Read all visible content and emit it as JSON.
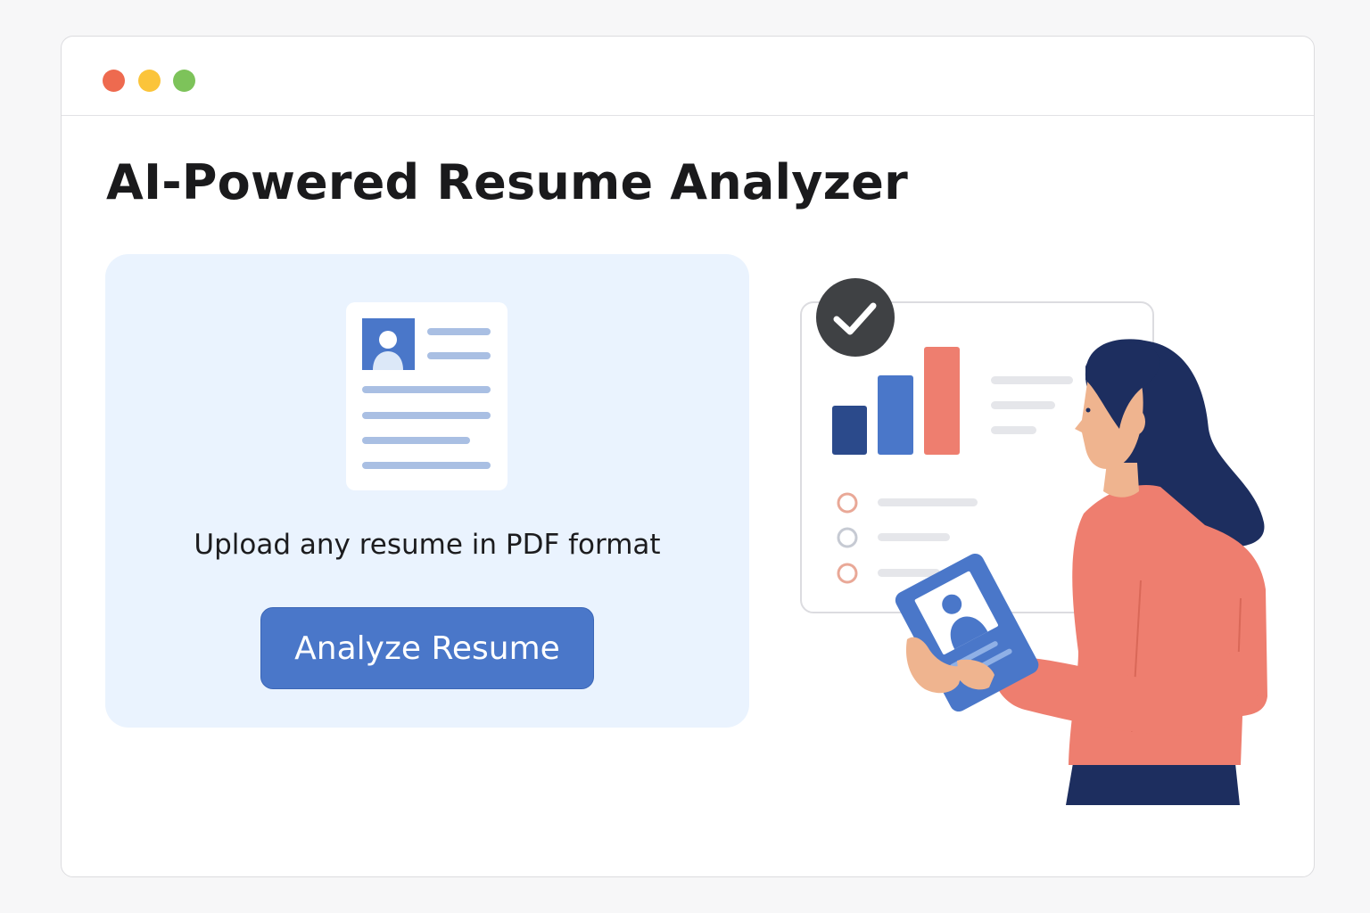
{
  "window": {
    "controls": [
      {
        "name": "close",
        "color": "#ee6a4f"
      },
      {
        "name": "minimize",
        "color": "#fbc43a"
      },
      {
        "name": "maximize",
        "color": "#7dc35a"
      }
    ]
  },
  "page": {
    "title": "AI-Powered Resume Analyzer"
  },
  "upload": {
    "icon": "resume-document-icon",
    "instruction": "Upload any resume in PDF format",
    "button_label": "Analyze Resume"
  },
  "illustration": {
    "description_icon": "woman-with-tablet-illustration",
    "check_icon": "checkmark-badge-icon",
    "chart_icon": "bar-chart-icon"
  },
  "colors": {
    "accent": "#4a77c9",
    "card_bg": "#eaf3fe",
    "navy": "#1d2e5f",
    "coral": "#ee7e6f",
    "skin": "#efb48f"
  }
}
